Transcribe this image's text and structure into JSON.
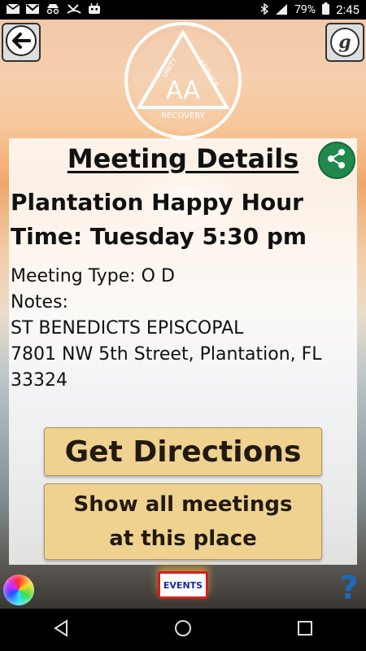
{
  "status_bar": {
    "left_icons": [
      "mail-icon",
      "gmail-icon",
      "incognito-icon",
      "missed-call-icon",
      "robot-icon"
    ],
    "right_icons": [
      "bluetooth-icon",
      "lte-signal-icon",
      "battery-icon"
    ],
    "battery": "79%",
    "time": "2:45"
  },
  "header": {
    "logo_text_top_left": "UNITY",
    "logo_text_top_right": "SERVICE",
    "logo_text_bottom": "RECOVERY",
    "logo_center": "AA",
    "g_button": "g"
  },
  "card": {
    "title": "Meeting Details",
    "meeting_name": "Plantation Happy Hour",
    "meeting_time": "Time: Tuesday 5:30 pm",
    "meeting_type": "Meeting Type: O D",
    "notes_label": "Notes:",
    "location": "ST BENEDICTS EPISCOPAL",
    "address_line1": "7801 NW 5th Street, Plantation, FL",
    "address_line2": "33324"
  },
  "buttons": {
    "directions": "Get Directions",
    "all_meetings_line1": "Show all meetings",
    "all_meetings_line2": "at this place"
  },
  "footer": {
    "events": "EVENTS",
    "help": "?"
  },
  "colors": {
    "share": "#1f8a4c",
    "button_bg": "#efd28f",
    "events_border": "#d41f1f",
    "help": "#1d6ab8"
  }
}
